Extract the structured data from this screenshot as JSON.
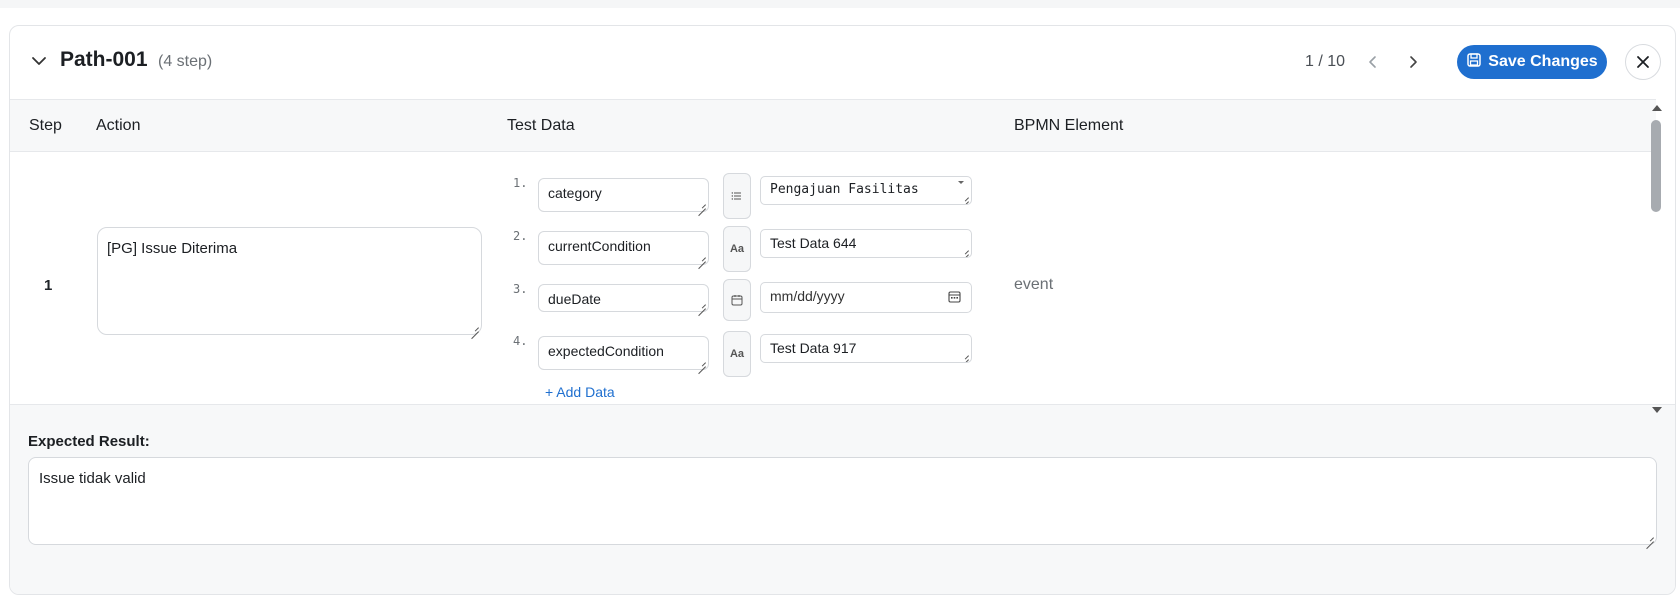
{
  "header": {
    "path_title": "Path-001",
    "step_count": "(4 step)",
    "pager": "1 / 10",
    "save_label": "Save Changes"
  },
  "table": {
    "columns": [
      "Step",
      "Action",
      "Test Data",
      "BPMN Element"
    ],
    "rows": [
      {
        "step": "1",
        "action": "[PG] Issue Diterima",
        "bpmn": "event",
        "test_data": [
          {
            "num": "1.",
            "key": "category",
            "type_icon": "list-icon",
            "value": "Pengajuan Fasilitas"
          },
          {
            "num": "2.",
            "key": "currentCondition",
            "type_icon": "text-icon",
            "type_label": "Aa",
            "value": "Test Data 644"
          },
          {
            "num": "3.",
            "key": "dueDate",
            "type_icon": "calendar-icon",
            "placeholder": "mm/dd/yyyy"
          },
          {
            "num": "4.",
            "key": "expectedCondition",
            "type_icon": "text-icon",
            "type_label": "Aa",
            "value": "Test Data 917"
          }
        ],
        "add_data_label": "+ Add Data"
      }
    ]
  },
  "expected": {
    "label": "Expected Result:",
    "value": "Issue tidak valid"
  },
  "colors": {
    "primary": "#1f6fcf",
    "border": "#d6d9dd",
    "muted_text": "#6b7075"
  }
}
